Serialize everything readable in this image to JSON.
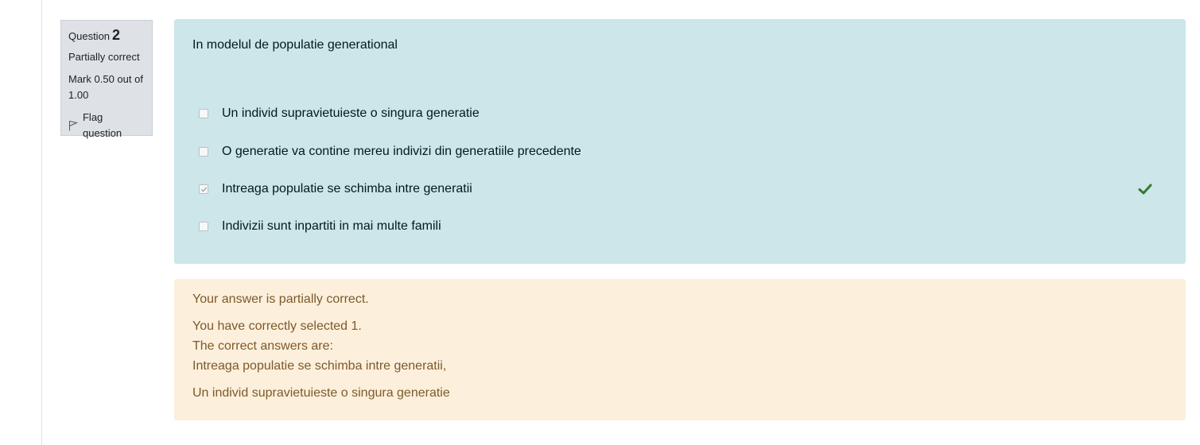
{
  "info": {
    "question_word": "Question",
    "question_number": "2",
    "state": "Partially correct",
    "grade": "Mark 0.50 out of 1.00",
    "flag_label": "Flag question"
  },
  "question": {
    "text": "In modelul de populatie generational",
    "answers": [
      {
        "label": "Un individ supravietuieste o singura generatie",
        "checked": false
      },
      {
        "label": "O generatie va contine mereu indivizi din generatiile precedente",
        "checked": false
      },
      {
        "label": "Intreaga populatie se schimba intre generatii",
        "checked": true,
        "correct_mark": true
      },
      {
        "label": "Indivizii sunt inpartiti in mai multe famili",
        "checked": false
      }
    ]
  },
  "feedback": {
    "general": "Your answer is partially correct.",
    "selected": "You have correctly selected 1.",
    "correct_intro": "The correct answers are:",
    "correct_1": "Intreaga populatie se schimba intre generatii,",
    "correct_2": "Un individ supravietuieste o singura generatie"
  },
  "colors": {
    "formulation_bg": "#cce6ea",
    "feedback_bg": "#fcefdc",
    "correct_check": "#357a32"
  }
}
